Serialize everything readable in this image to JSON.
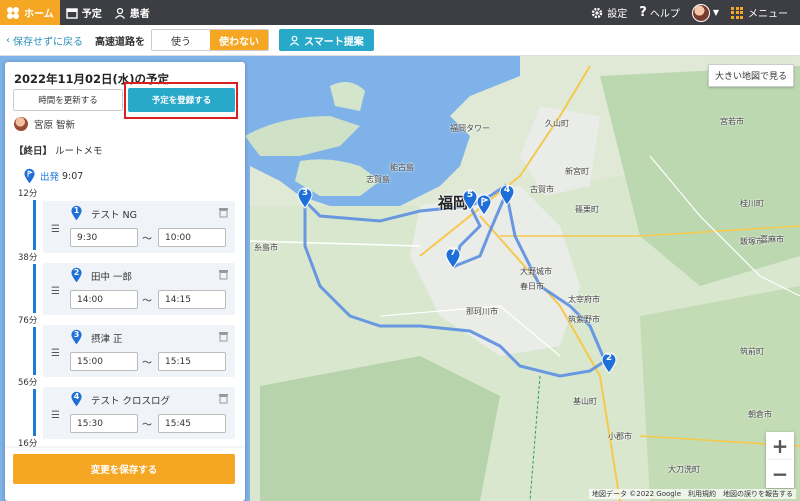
{
  "nav": {
    "home": "ホーム",
    "schedule": "予定",
    "patients": "患者",
    "settings": "設定",
    "help": "ヘルプ",
    "user_caret": "▼",
    "menu": "メニュー"
  },
  "toolbar": {
    "back": "保存せずに戻る",
    "highway_label": "高速道路を",
    "use": "使う",
    "not_use": "使わない",
    "smart_suggest": "スマート提案"
  },
  "panel": {
    "title": "2022年11月02日(水)の予定",
    "update_time": "時間を更新する",
    "register": "予定を登録する",
    "staff_name": "宮原 智新",
    "allday_tag": "【終日】",
    "allday_memo": "ルートメモ",
    "depart_label": "出発",
    "depart_time": "9:07",
    "gaps": [
      "12分",
      "38分",
      "76分",
      "56分",
      "16分"
    ],
    "visits": [
      {
        "no": "1",
        "name": "テスト NG",
        "start": "9:30",
        "end": "10:00"
      },
      {
        "no": "2",
        "name": "田中 一郎",
        "start": "14:00",
        "end": "14:15"
      },
      {
        "no": "3",
        "name": "摂津 正",
        "start": "15:00",
        "end": "15:15"
      },
      {
        "no": "4",
        "name": "テスト クロスログ",
        "start": "15:30",
        "end": "15:45"
      }
    ],
    "tilde": "〜",
    "save": "変更を保存する"
  },
  "map": {
    "big_map": "大きい地図で見る",
    "zoom_in": "+",
    "zoom_out": "−",
    "credit": "地図データ ©2022 Google　利用規約　地図の誤りを報告する",
    "city": "福岡",
    "places": [
      "福岡タワー",
      "志賀島",
      "新宮町",
      "古賀市",
      "篠栗町",
      "飯塚市",
      "太宰府市",
      "筑紫野市",
      "大野城市",
      "春日市",
      "那珂川市",
      "糸島市",
      "筑前町",
      "小郡市",
      "朝倉市",
      "久山町",
      "宮若市",
      "桂川町",
      "嘉麻市",
      "基山町",
      "能古島",
      "大刀洗町"
    ],
    "route_color": "#5b8fe0",
    "pin_color": "#1e6fd8"
  },
  "colors": {
    "accent": "#f5a623",
    "primary": "#28a9c9",
    "highlight": "#d92121"
  }
}
